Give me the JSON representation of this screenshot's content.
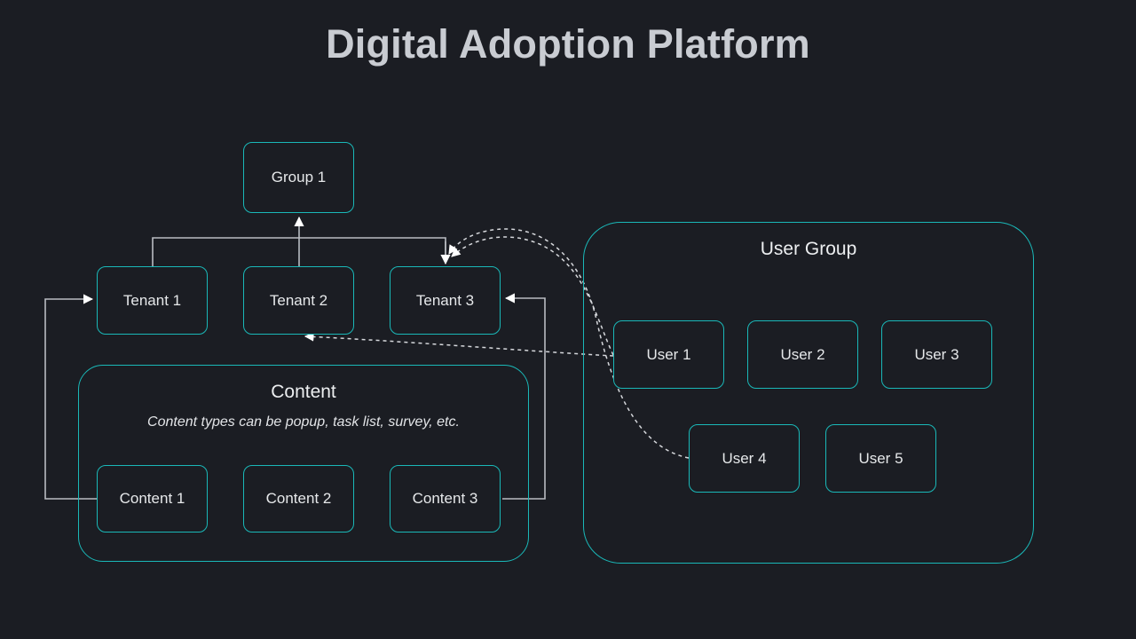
{
  "page": {
    "title": "Digital Adoption Platform",
    "background_color": "#1b1d23",
    "accent_color": "#1ab8b8",
    "connector_color": "#b9bcc2",
    "text_color": "#e6e8ea"
  },
  "group_node": {
    "label": "Group 1"
  },
  "tenants": [
    {
      "label": "Tenant 1"
    },
    {
      "label": "Tenant 2"
    },
    {
      "label": "Tenant 3"
    }
  ],
  "content_container": {
    "title": "Content",
    "subtitle": "Content types can be popup, task list, survey, etc.",
    "items": [
      {
        "label": "Content 1"
      },
      {
        "label": "Content 2"
      },
      {
        "label": "Content 3"
      }
    ]
  },
  "user_group_container": {
    "title": "User Group",
    "items": [
      {
        "label": "User 1"
      },
      {
        "label": "User 2"
      },
      {
        "label": "User 3"
      },
      {
        "label": "User 4"
      },
      {
        "label": "User 5"
      }
    ]
  },
  "connectors": [
    {
      "name": "tenant-bus-to-group1",
      "from": "Tenant 1 / Tenant 2 / Tenant 3 bus",
      "to": "Group 1",
      "style": "solid",
      "arrow": true
    },
    {
      "name": "bus-to-tenant3",
      "from": "bus",
      "to": "Tenant 3",
      "style": "solid",
      "arrow": true
    },
    {
      "name": "content1-to-tenant1",
      "from": "Content 1",
      "to": "Tenant 1",
      "style": "solid",
      "arrow": true
    },
    {
      "name": "content3-to-tenant3",
      "from": "Content 3",
      "to": "Tenant 3",
      "style": "solid",
      "arrow": true
    },
    {
      "name": "user1-to-tenant2",
      "from": "User 1",
      "to": "Tenant 2",
      "style": "dashed",
      "arrow": true
    },
    {
      "name": "user1-to-tenant3",
      "from": "User 1",
      "to": "Tenant 3",
      "style": "dashed",
      "arrow": true
    },
    {
      "name": "user4-to-tenant3",
      "from": "User 4",
      "to": "Tenant 3",
      "style": "dashed",
      "arrow": true
    }
  ]
}
